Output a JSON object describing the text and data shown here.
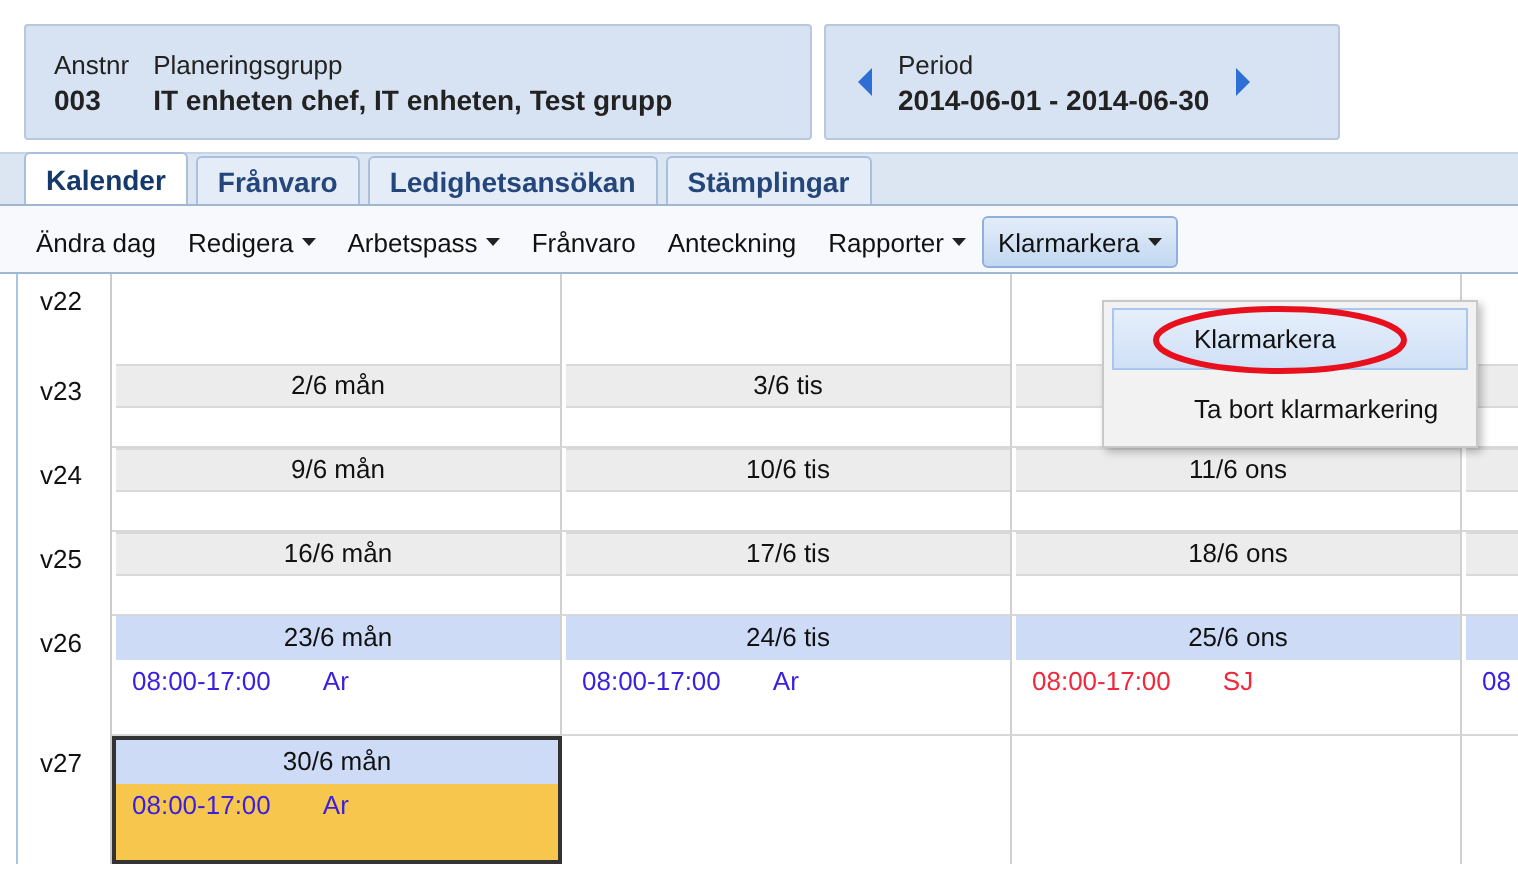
{
  "header": {
    "employee": {
      "label": "Anstnr",
      "value": "003"
    },
    "group": {
      "label": "Planeringsgrupp",
      "value": "IT enheten chef, IT enheten, Test grupp"
    },
    "period": {
      "label": "Period",
      "value": "2014-06-01 - 2014-06-30"
    }
  },
  "tabs": [
    {
      "label": "Kalender",
      "selected": true
    },
    {
      "label": "Frånvaro",
      "selected": false
    },
    {
      "label": "Ledighetsansökan",
      "selected": false
    },
    {
      "label": "Stämplingar",
      "selected": false
    }
  ],
  "toolbar": [
    {
      "label": "Ändra dag",
      "dropdown": false,
      "selected": false
    },
    {
      "label": "Redigera",
      "dropdown": true,
      "selected": false
    },
    {
      "label": "Arbetspass",
      "dropdown": true,
      "selected": false
    },
    {
      "label": "Frånvaro",
      "dropdown": false,
      "selected": false
    },
    {
      "label": "Anteckning",
      "dropdown": false,
      "selected": false
    },
    {
      "label": "Rapporter",
      "dropdown": true,
      "selected": false
    },
    {
      "label": "Klarmarkera",
      "dropdown": true,
      "selected": true
    }
  ],
  "menu": [
    {
      "label": "Klarmarkera",
      "selected": true,
      "circled": true
    },
    {
      "label": "Ta bort klarmarkering",
      "selected": false,
      "circled": false
    }
  ],
  "weeks": [
    {
      "week": "v22",
      "days": [
        {
          "kind": "blank"
        },
        {
          "kind": "blank"
        },
        {
          "kind": "blank"
        },
        {
          "kind": "blank"
        }
      ]
    },
    {
      "week": "v23",
      "days": [
        {
          "kind": "day",
          "date": "2/6 mån",
          "selected": false,
          "highlighted": false
        },
        {
          "kind": "day",
          "date": "3/6 tis",
          "selected": false,
          "highlighted": false
        },
        {
          "kind": "cut",
          "highlighted": false
        },
        {
          "kind": "cut",
          "highlighted": false
        }
      ]
    },
    {
      "week": "v24",
      "days": [
        {
          "kind": "day",
          "date": "9/6 mån",
          "selected": false,
          "highlighted": false
        },
        {
          "kind": "day",
          "date": "10/6 tis",
          "selected": false,
          "highlighted": false
        },
        {
          "kind": "day",
          "date": "11/6 ons",
          "selected": false,
          "highlighted": false
        },
        {
          "kind": "cut",
          "highlighted": false
        }
      ]
    },
    {
      "week": "v25",
      "days": [
        {
          "kind": "day",
          "date": "16/6 mån",
          "selected": false,
          "highlighted": false
        },
        {
          "kind": "day",
          "date": "17/6 tis",
          "selected": false,
          "highlighted": false
        },
        {
          "kind": "day",
          "date": "18/6 ons",
          "selected": false,
          "highlighted": false
        },
        {
          "kind": "cut",
          "highlighted": false
        }
      ]
    },
    {
      "week": "v26",
      "days": [
        {
          "kind": "day",
          "date": "23/6 mån",
          "selected": false,
          "highlighted": true,
          "entries": [
            {
              "time": "08:00-17:00",
              "code": "Ar",
              "kind": "work"
            }
          ]
        },
        {
          "kind": "day",
          "date": "24/6 tis",
          "selected": false,
          "highlighted": true,
          "entries": [
            {
              "time": "08:00-17:00",
              "code": "Ar",
              "kind": "work"
            }
          ]
        },
        {
          "kind": "day",
          "date": "25/6 ons",
          "selected": false,
          "highlighted": true,
          "entries": [
            {
              "time": "08:00-17:00",
              "code": "SJ",
              "kind": "absence"
            }
          ]
        },
        {
          "kind": "cut",
          "highlighted": true,
          "entries": [
            {
              "time": "08",
              "kind": "work"
            }
          ]
        }
      ]
    },
    {
      "week": "v27",
      "days": [
        {
          "kind": "day",
          "date": "30/6 mån",
          "selected": true,
          "highlighted": true,
          "entries": [
            {
              "time": "08:00-17:00",
              "code": "Ar",
              "kind": "work"
            }
          ]
        },
        {
          "kind": "blank"
        },
        {
          "kind": "blank"
        },
        {
          "kind": "blank"
        }
      ]
    }
  ]
}
